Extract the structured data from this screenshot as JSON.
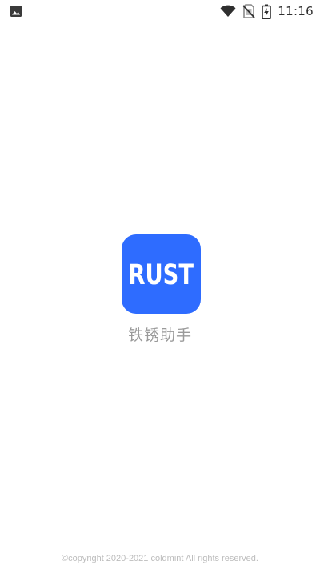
{
  "status_bar": {
    "time": "11:16",
    "icons": [
      "image-icon",
      "wifi-icon",
      "no-sim-icon",
      "battery-charging-icon"
    ]
  },
  "splash": {
    "logo_text": "RUST",
    "logo_color": "#2e6cff",
    "app_name": "铁锈助手"
  },
  "footer": {
    "copyright": "©copyright 2020-2021 coldmint All rights reserved."
  }
}
